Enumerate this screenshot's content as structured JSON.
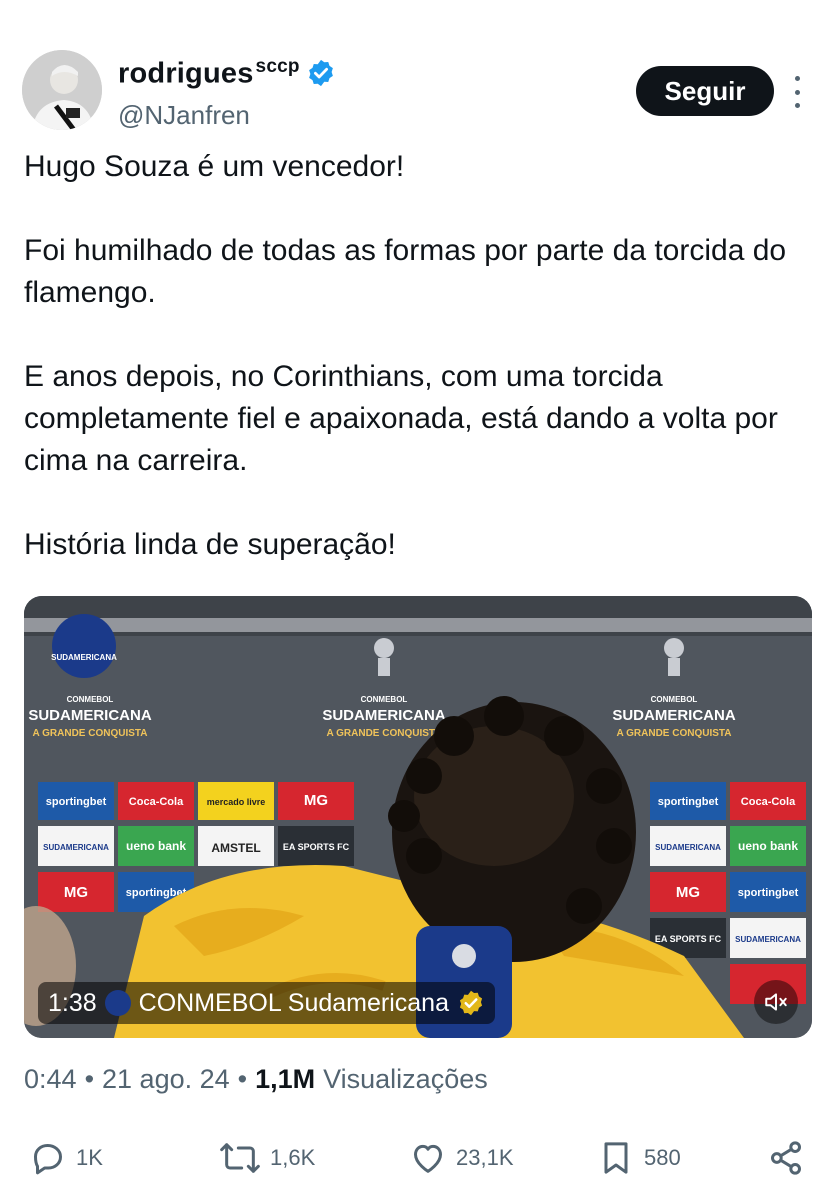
{
  "author": {
    "display_name": "rodrigues",
    "display_suffix": "sccp",
    "handle": "@NJanfren",
    "verified": true
  },
  "follow_label": "Seguir",
  "tweet": {
    "paragraphs": [
      "Hugo Souza é um vencedor!",
      "Foi humilhado de todas as formas por parte da torcida do flamengo.",
      "E anos depois, no Corinthians, com uma torcida completamente fiel e apaixonada, está dando a volta por cima na carreira.",
      "História linda de superação!"
    ]
  },
  "media": {
    "duration": "1:38",
    "channel": "CONMEBOL Sudamericana",
    "board_texts": {
      "conmebol": "CONMEBOL",
      "sudamericana": "SUDAMERICANA",
      "grande": "A GRANDE CONQUISTA",
      "sportingbet": "sportingbet",
      "cocacola": "Coca-Cola",
      "mercadolivre": "mercado livre",
      "mg": "MG",
      "uenobank": "ueno bank",
      "amstel": "AMSTEL",
      "ea": "EA SPORTS FC"
    },
    "colors": {
      "jersey": "#f2c230",
      "board_red": "#d6262f",
      "board_blue": "#1e5aa8",
      "board_green": "#3aa650"
    }
  },
  "meta": {
    "time": "0:44",
    "date": "21 ago. 24",
    "views_count": "1,1M",
    "views_label": "Visualizações",
    "separator": "•"
  },
  "actions": {
    "replies": "1K",
    "reposts": "1,6K",
    "likes": "23,1K",
    "bookmarks": "580"
  }
}
